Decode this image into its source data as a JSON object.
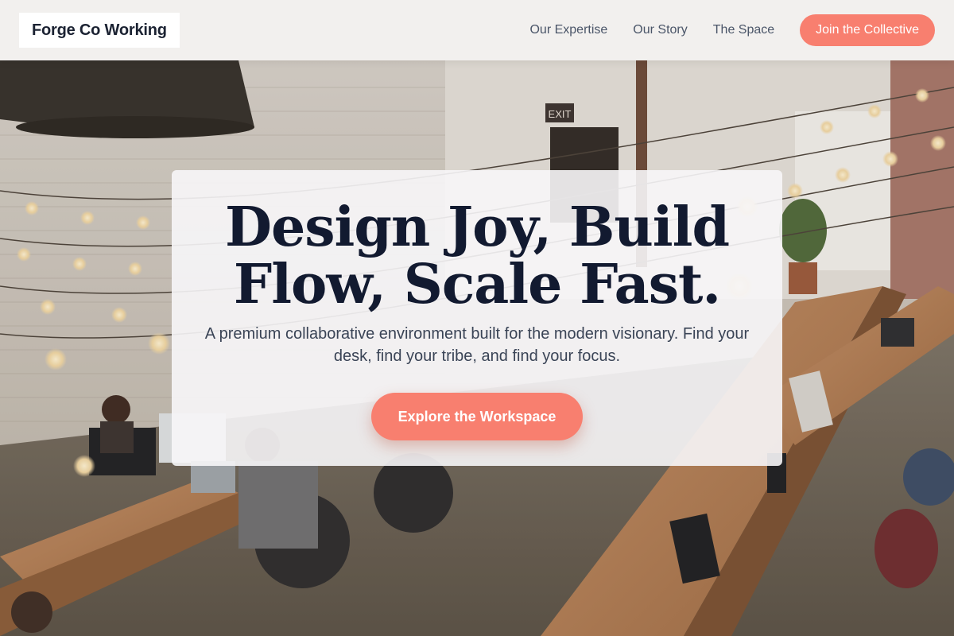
{
  "header": {
    "logo_text": "Forge Co Working",
    "nav": [
      {
        "label": "Our Expertise"
      },
      {
        "label": "Our Story"
      },
      {
        "label": "The Space"
      }
    ],
    "cta_label": "Join the Collective"
  },
  "hero": {
    "title": "Design Joy, Build Flow, Scale Fast.",
    "subtitle": "A premium collaborative environment built for the modern visionary. Find your desk, find your tribe, and find your focus.",
    "button_label": "Explore the Workspace"
  },
  "background": {
    "exit_sign": "EXIT"
  },
  "colors": {
    "accent": "#f87f6f",
    "heading": "#121a30",
    "nav_text": "#4a5568"
  }
}
